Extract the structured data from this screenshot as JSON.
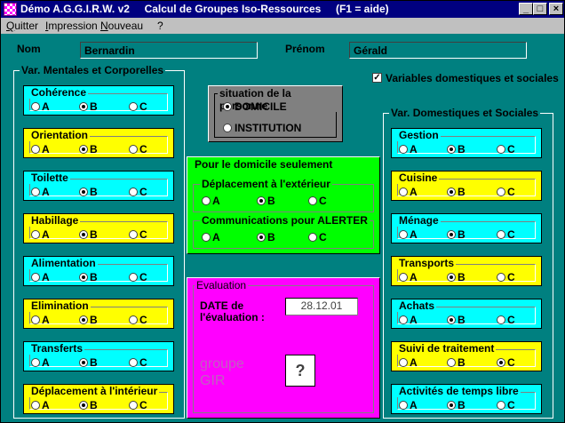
{
  "window": {
    "title": "Démo A.G.G.I.R.W. v2     Calcul de Groupes Iso-Ressources     (F1 = aide)",
    "minimize": "_",
    "maximize": "□",
    "close": "×"
  },
  "menu": [
    "Quitter",
    "Impression",
    "Nouveau",
    "?"
  ],
  "header": {
    "nom_label": "Nom",
    "nom_value": "Bernardin",
    "prenom_label": "Prénom",
    "prenom_value": "Gérald",
    "check_label": "Variables domestiques et sociales"
  },
  "left_group": {
    "title": "Var. Mentales et Corporelles",
    "items": [
      {
        "label": "Cohérence",
        "selected": "B",
        "color": "#00ffff"
      },
      {
        "label": "Orientation",
        "selected": "B",
        "color": "#ffff00"
      },
      {
        "label": "Toilette",
        "selected": "B",
        "color": "#00ffff"
      },
      {
        "label": "Habillage",
        "selected": "B",
        "color": "#ffff00"
      },
      {
        "label": "Alimentation",
        "selected": "B",
        "color": "#00ffff"
      },
      {
        "label": "Elimination",
        "selected": "B",
        "color": "#ffff00"
      },
      {
        "label": "Transferts",
        "selected": "B",
        "color": "#00ffff"
      },
      {
        "label": "Déplacement à l'intérieur",
        "selected": "B",
        "color": "#ffff00"
      }
    ]
  },
  "right_group": {
    "title": "Var. Domestiques et Sociales",
    "items": [
      {
        "label": "Gestion",
        "selected": "B",
        "color": "#00ffff"
      },
      {
        "label": "Cuisine",
        "selected": "B",
        "color": "#ffff00"
      },
      {
        "label": "Ménage",
        "selected": "B",
        "color": "#00ffff"
      },
      {
        "label": "Transports",
        "selected": "B",
        "color": "#ffff00"
      },
      {
        "label": "Achats",
        "selected": "B",
        "color": "#00ffff"
      },
      {
        "label": "Suivi de traitement",
        "selected": "C",
        "color": "#ffff00"
      },
      {
        "label": "Activités de temps libre",
        "selected": "B",
        "color": "#00ffff"
      }
    ]
  },
  "options": [
    "A",
    "B",
    "C"
  ],
  "situation": {
    "title": "situation de la personne",
    "options": [
      "DOMICILE",
      "INSTITUTION"
    ],
    "selected": "DOMICILE"
  },
  "domicile": {
    "title": "Pour le domicile seulement",
    "items": [
      {
        "label": "Déplacement à l'extérieur",
        "selected": "B"
      },
      {
        "label": "Communications pour ALERTER",
        "selected": "B"
      }
    ]
  },
  "evaluation": {
    "title": "Evaluation",
    "date_label_1": "DATE de",
    "date_label_2": "l'évaluation :",
    "date_value": "28.12.01",
    "gir_label_1": "groupe",
    "gir_label_2": "GIR",
    "gir_value": "?"
  },
  "colors": {
    "background": "#008080",
    "titlebar": "#000080",
    "cyan": "#00ffff",
    "yellow": "#ffff00",
    "green": "#00ff00",
    "magenta": "#ff00ff",
    "situation_bg": "#808080"
  }
}
